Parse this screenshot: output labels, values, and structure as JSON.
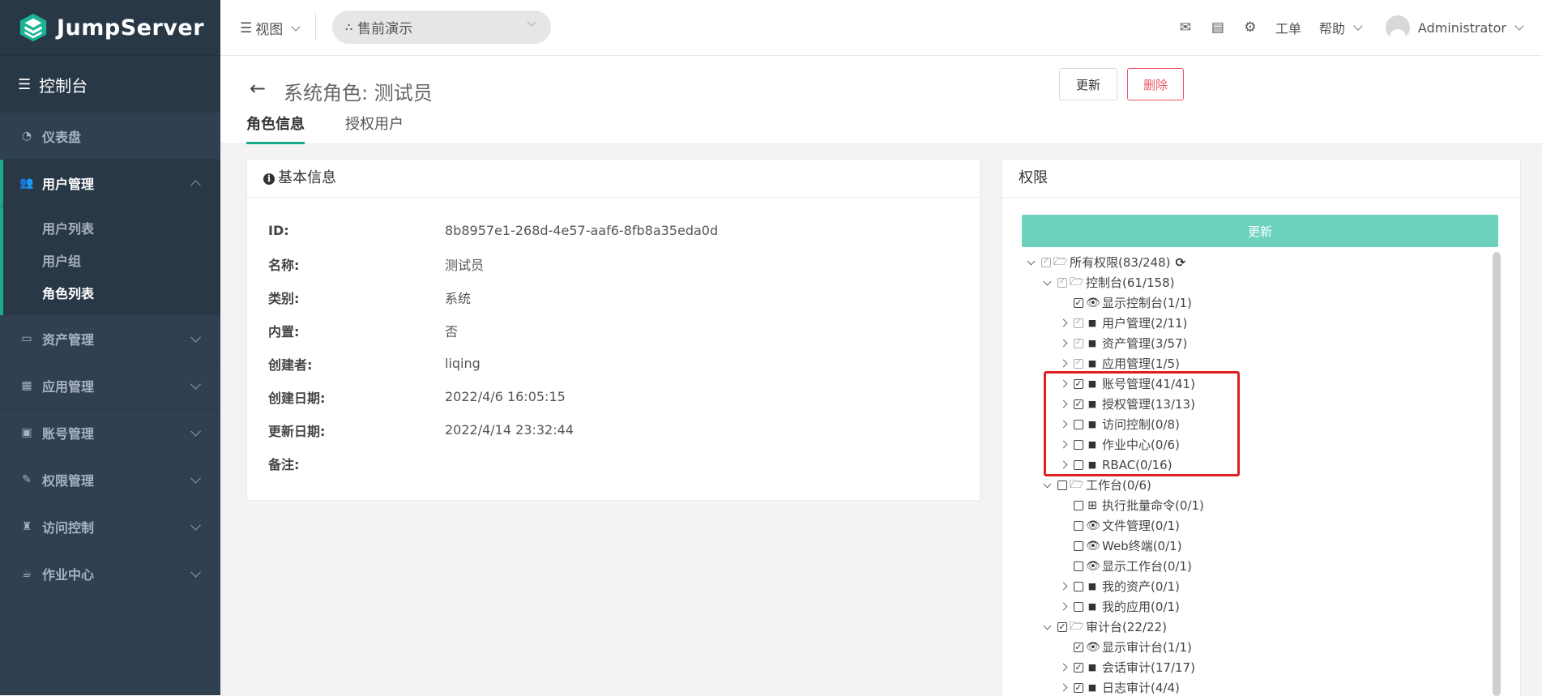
{
  "brand": {
    "name": "JumpServer"
  },
  "sidebar": {
    "console_label": "控制台",
    "items": [
      {
        "label": "仪表盘",
        "icon": "dashboard-icon"
      },
      {
        "label": "用户管理",
        "icon": "users-icon",
        "open": true,
        "children": [
          {
            "label": "用户列表"
          },
          {
            "label": "用户组"
          },
          {
            "label": "角色列表",
            "active": true
          }
        ]
      },
      {
        "label": "资产管理",
        "icon": "hdd-icon"
      },
      {
        "label": "应用管理",
        "icon": "grid-icon"
      },
      {
        "label": "账号管理",
        "icon": "account-icon"
      },
      {
        "label": "权限管理",
        "icon": "edit-icon"
      },
      {
        "label": "访问控制",
        "icon": "sitemap-icon"
      },
      {
        "label": "作业中心",
        "icon": "coffee-icon"
      }
    ]
  },
  "topbar": {
    "view_label": "视图",
    "org_select_value": "售前演示",
    "ticket_label": "工单",
    "help_label": "帮助",
    "user_name": "Administrator"
  },
  "page": {
    "title": "系统角色: 测试员",
    "tabs": [
      {
        "label": "角色信息",
        "active": true
      },
      {
        "label": "授权用户"
      }
    ],
    "update_label": "更新",
    "delete_label": "删除"
  },
  "basic_info": {
    "title": "基本信息",
    "rows": [
      {
        "label": "ID:",
        "value": "8b8957e1-268d-4e57-aaf6-8fb8a35eda0d"
      },
      {
        "label": "名称:",
        "value": "测试员"
      },
      {
        "label": "类别:",
        "value": "系统"
      },
      {
        "label": "内置:",
        "value": "否"
      },
      {
        "label": "创建者:",
        "value": "liqing"
      },
      {
        "label": "创建日期:",
        "value": "2022/4/6 16:05:15"
      },
      {
        "label": "更新日期:",
        "value": "2022/4/14 23:32:44"
      },
      {
        "label": "备注:",
        "value": ""
      }
    ]
  },
  "permissions": {
    "title": "权限",
    "update_label": "更新",
    "tree": [
      {
        "label": "所有权限(83/248)",
        "level": 0,
        "toggle": "exp",
        "check": "partial",
        "icon": "folder-open-icon",
        "refresh": true
      },
      {
        "label": "控制台(61/158)",
        "level": 1,
        "toggle": "exp",
        "check": "partial",
        "icon": "folder-open-icon"
      },
      {
        "label": "显示控制台(1/1)",
        "level": 2,
        "toggle": "none",
        "check": "checked",
        "icon": "eye-icon"
      },
      {
        "label": "用户管理(2/11)",
        "level": 2,
        "toggle": "col",
        "check": "partial",
        "icon": "folder-icon"
      },
      {
        "label": "资产管理(3/57)",
        "level": 2,
        "toggle": "col",
        "check": "partial",
        "icon": "folder-icon"
      },
      {
        "label": "应用管理(1/5)",
        "level": 2,
        "toggle": "col",
        "check": "partial",
        "icon": "folder-icon"
      },
      {
        "label": "账号管理(41/41)",
        "level": 2,
        "toggle": "col",
        "check": "checked",
        "icon": "folder-icon"
      },
      {
        "label": "授权管理(13/13)",
        "level": 2,
        "toggle": "col",
        "check": "checked",
        "icon": "folder-icon"
      },
      {
        "label": "访问控制(0/8)",
        "level": 2,
        "toggle": "col",
        "check": "none",
        "icon": "folder-icon"
      },
      {
        "label": "作业中心(0/6)",
        "level": 2,
        "toggle": "col",
        "check": "none",
        "icon": "folder-icon"
      },
      {
        "label": "RBAC(0/16)",
        "level": 2,
        "toggle": "col",
        "check": "none",
        "icon": "folder-icon"
      },
      {
        "label": "工作台(0/6)",
        "level": 1,
        "toggle": "exp",
        "check": "none",
        "icon": "folder-open-icon"
      },
      {
        "label": "执行批量命令(0/1)",
        "level": 2,
        "toggle": "none",
        "check": "none",
        "icon": "plus-square-icon"
      },
      {
        "label": "文件管理(0/1)",
        "level": 2,
        "toggle": "none",
        "check": "none",
        "icon": "eye-icon"
      },
      {
        "label": "Web终端(0/1)",
        "level": 2,
        "toggle": "none",
        "check": "none",
        "icon": "eye-icon"
      },
      {
        "label": "显示工作台(0/1)",
        "level": 2,
        "toggle": "none",
        "check": "none",
        "icon": "eye-icon"
      },
      {
        "label": "我的资产(0/1)",
        "level": 2,
        "toggle": "col",
        "check": "none",
        "icon": "folder-icon"
      },
      {
        "label": "我的应用(0/1)",
        "level": 2,
        "toggle": "col",
        "check": "none",
        "icon": "folder-icon"
      },
      {
        "label": "审计台(22/22)",
        "level": 1,
        "toggle": "exp",
        "check": "checked",
        "icon": "folder-open-icon"
      },
      {
        "label": "显示审计台(1/1)",
        "level": 2,
        "toggle": "none",
        "check": "checked",
        "icon": "eye-icon"
      },
      {
        "label": "会话审计(17/17)",
        "level": 2,
        "toggle": "col",
        "check": "checked",
        "icon": "folder-icon"
      },
      {
        "label": "日志审计(4/4)",
        "level": 2,
        "toggle": "col",
        "check": "checked",
        "icon": "folder-icon"
      }
    ]
  },
  "colors": {
    "accent": "#19aa8d",
    "sidebar": "#2f4050",
    "danger": "#ed5565",
    "highlight": "#e02020"
  }
}
